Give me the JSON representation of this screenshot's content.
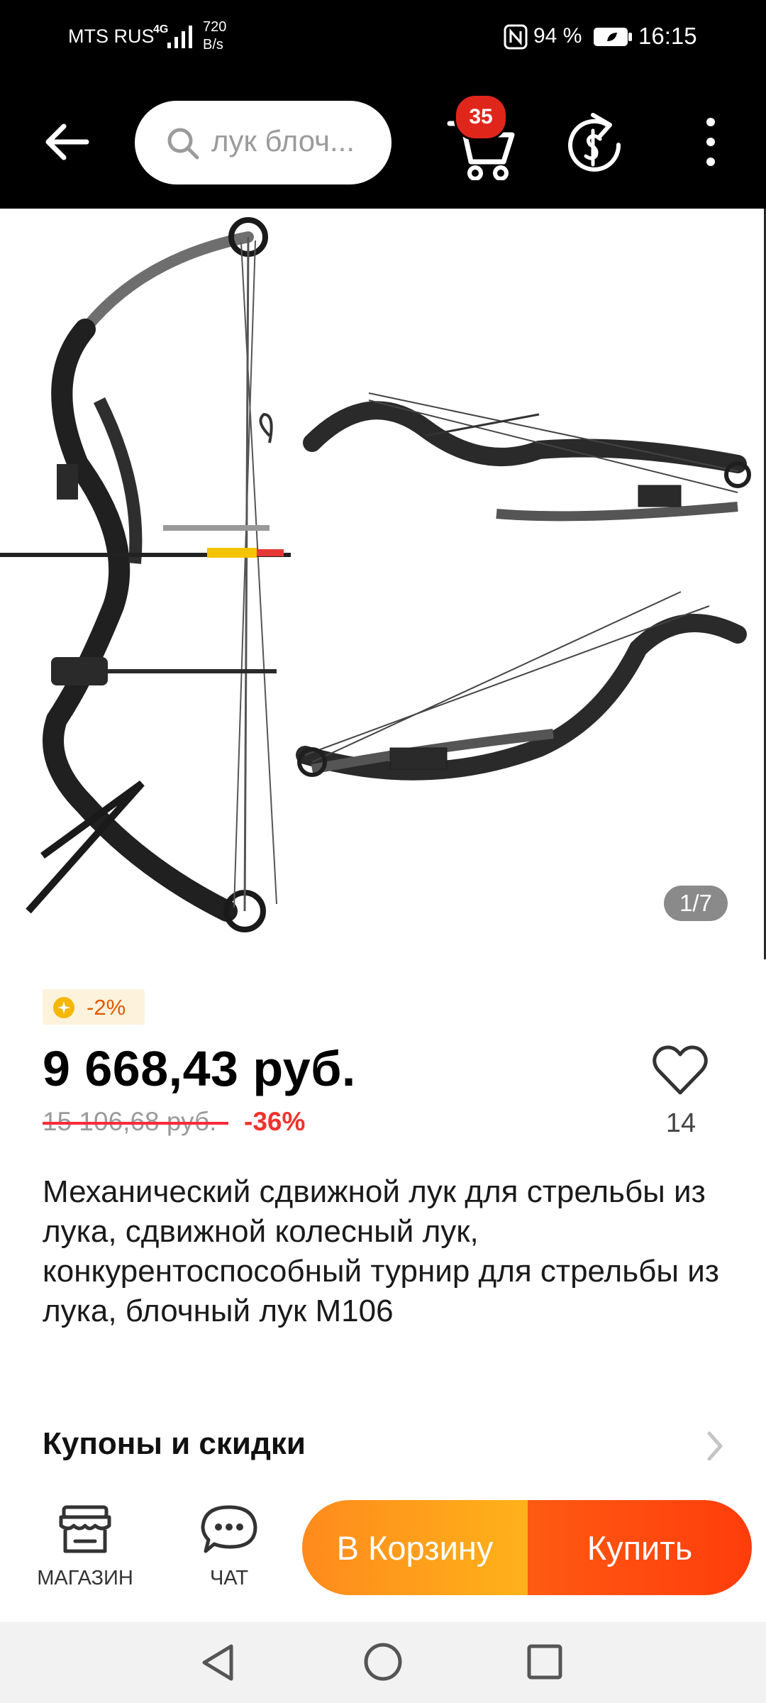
{
  "status_bar": {
    "carrier": "MTS RUS",
    "network": "4G",
    "speed_value": "720",
    "speed_unit": "B/s",
    "battery_percent": "94 %",
    "time": "16:15"
  },
  "header": {
    "search_text": "лук блоч...",
    "cart_badge": "35"
  },
  "gallery": {
    "counter": "1/7"
  },
  "product": {
    "coin_discount": "-2%",
    "price": "9 668,43 руб.",
    "old_price": "15 106,68 руб.",
    "discount": "-36%",
    "favorites_count": "14",
    "title": "Механический сдвижной лук для стрельбы из лука, сдвижной колесный лук, конкурентоспособный турнир для стрельбы из лука, блочный лук M106"
  },
  "coupons": {
    "label": "Купоны и скидки"
  },
  "bottom_bar": {
    "store_label": "МАГАЗИН",
    "chat_label": "ЧАТ",
    "add_to_cart_label": "В Корзину",
    "buy_label": "Купить"
  },
  "colors": {
    "accent_orange": "#ff8a1c",
    "accent_red": "#ff3d0c",
    "badge_red": "#e0261b",
    "discount_red": "#f0322d"
  }
}
